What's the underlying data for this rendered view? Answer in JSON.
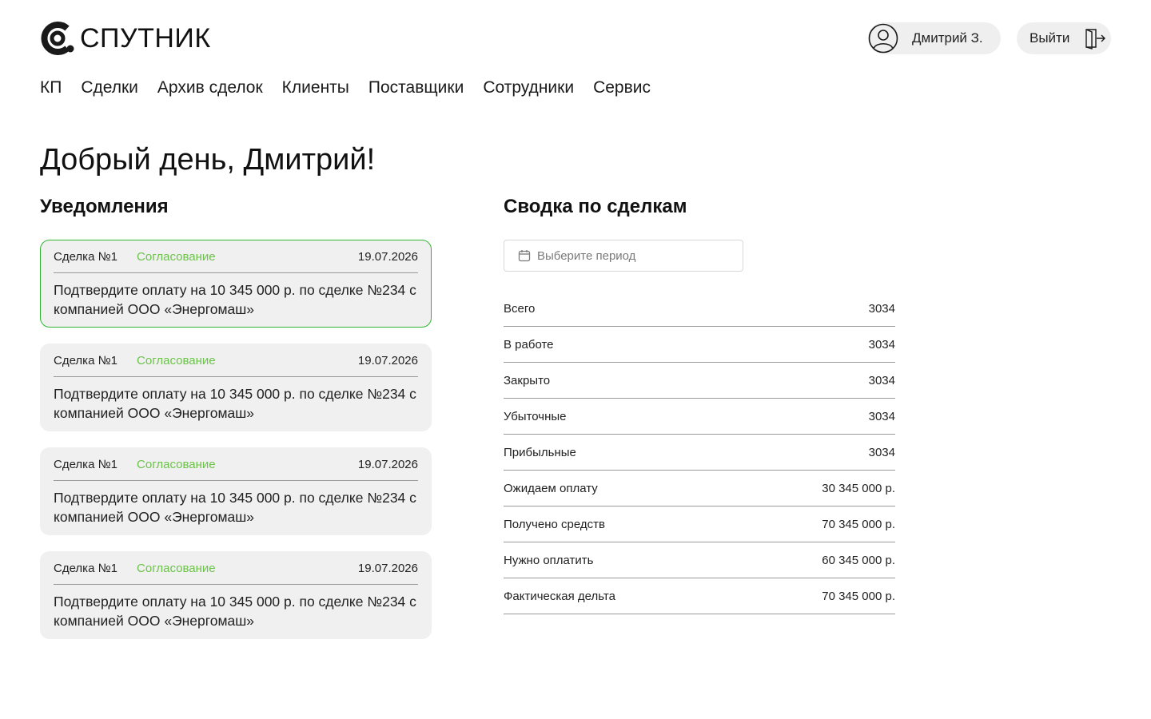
{
  "brand": {
    "name": "СПУТНИК",
    "logo_icon": "sputnik-logo-icon"
  },
  "user": {
    "name": "Дмитрий З.",
    "avatar_icon": "user-avatar-icon"
  },
  "logout": {
    "label": "Выйти",
    "icon": "logout-door-icon"
  },
  "nav": {
    "items": [
      {
        "label": "КП"
      },
      {
        "label": "Сделки"
      },
      {
        "label": "Архив сделок"
      },
      {
        "label": "Клиенты"
      },
      {
        "label": "Поставщики"
      },
      {
        "label": "Сотрудники"
      },
      {
        "label": "Сервис"
      }
    ]
  },
  "greeting": "Добрый день, Дмитрий!",
  "notifications": {
    "title": "Уведомления",
    "status_color": "#6cc24a",
    "active_border_color": "#2fb52f",
    "items": [
      {
        "deal": "Сделка №1",
        "status": "Согласование",
        "date": "19.07.2026",
        "text": "Подтвердите оплату на 10 345 000 р. по сделке №234 с компанией ООО «Энергомаш»",
        "active": true
      },
      {
        "deal": "Сделка №1",
        "status": "Согласование",
        "date": "19.07.2026",
        "text": "Подтвердите оплату на 10 345 000 р. по сделке №234 с компанией ООО «Энергомаш»",
        "active": false
      },
      {
        "deal": "Сделка №1",
        "status": "Согласование",
        "date": "19.07.2026",
        "text": "Подтвердите оплату на 10 345 000 р. по сделке №234 с компанией ООО «Энергомаш»",
        "active": false
      },
      {
        "deal": "Сделка №1",
        "status": "Согласование",
        "date": "19.07.2026",
        "text": "Подтвердите оплату на 10 345 000 р. по сделке №234 с компанией ООО «Энергомаш»",
        "active": false
      }
    ]
  },
  "summary": {
    "title": "Сводка по сделкам",
    "period_placeholder": "Выберите период",
    "period_icon": "calendar-icon",
    "rows": [
      {
        "label": "Всего",
        "value": "3034"
      },
      {
        "label": "В работе",
        "value": "3034"
      },
      {
        "label": "Закрыто",
        "value": "3034"
      },
      {
        "label": "Убыточные",
        "value": "3034"
      },
      {
        "label": "Прибыльные",
        "value": "3034"
      },
      {
        "label": "Ожидаем оплату",
        "value": "30 345 000 р."
      },
      {
        "label": "Получено средств",
        "value": "70 345 000 р."
      },
      {
        "label": "Нужно оплатить",
        "value": "60 345 000 р."
      },
      {
        "label": "Фактическая дельта",
        "value": "70 345 000 р."
      }
    ]
  }
}
